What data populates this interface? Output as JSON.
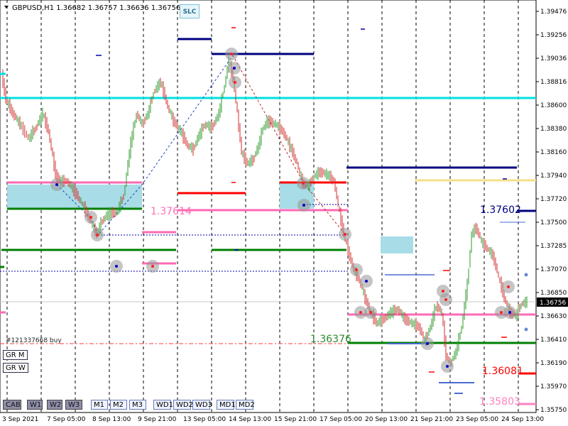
{
  "header": {
    "title": "GBPUSD,H1  1.36682 1.36757 1.36636 1.36756"
  },
  "slc_label": "SLC",
  "price_axis": [
    "1.39476",
    "1.39256",
    "1.39036",
    "1.38816",
    "1.38600",
    "1.38380",
    "1.38160",
    "1.37940",
    "1.37720",
    "1.37500",
    "1.37285",
    "1.37070",
    "1.36850",
    "1.36630",
    "1.36410",
    "1.36190",
    "1.35970",
    "1.35750"
  ],
  "current_price": "1.36756",
  "time_axis": [
    "3 Sep 2021",
    "7 Sep 05:00",
    "8 Sep 13:00",
    "9 Sep 21:00",
    "13 Sep 05:00",
    "14 Sep 13:00",
    "15 Sep 21:00",
    "17 Sep 05:00",
    "20 Sep 13:00",
    "21 Sep 21:00",
    "23 Sep 05:00",
    "24 Sep 13:00"
  ],
  "level_labels": [
    {
      "text": "1.37614",
      "color": "#ff6fb5"
    },
    {
      "text": "1.37602",
      "color": "#00007f"
    },
    {
      "text": "1.36376",
      "color": "#2e8b2e"
    },
    {
      "text": "1.36081",
      "color": "#ff0000"
    },
    {
      "text": "1.35803",
      "color": "#ff80c0"
    }
  ],
  "order_label": "#121337668 buy",
  "side_buttons": [
    "GR M",
    "GR W"
  ],
  "bottom_buttons": [
    "CAB",
    "W1",
    "W2",
    "W3",
    "M1",
    "M2",
    "M3",
    "WD1",
    "WD2",
    "WD3",
    "MD1",
    "MD2"
  ],
  "colors": {
    "cyan": "#00e0e0",
    "pink": "#ff69b4",
    "green": "#007f00",
    "navy": "#00007f",
    "red": "#ff0000",
    "yellow": "#f5e08a",
    "box": "#a8dce6"
  }
}
